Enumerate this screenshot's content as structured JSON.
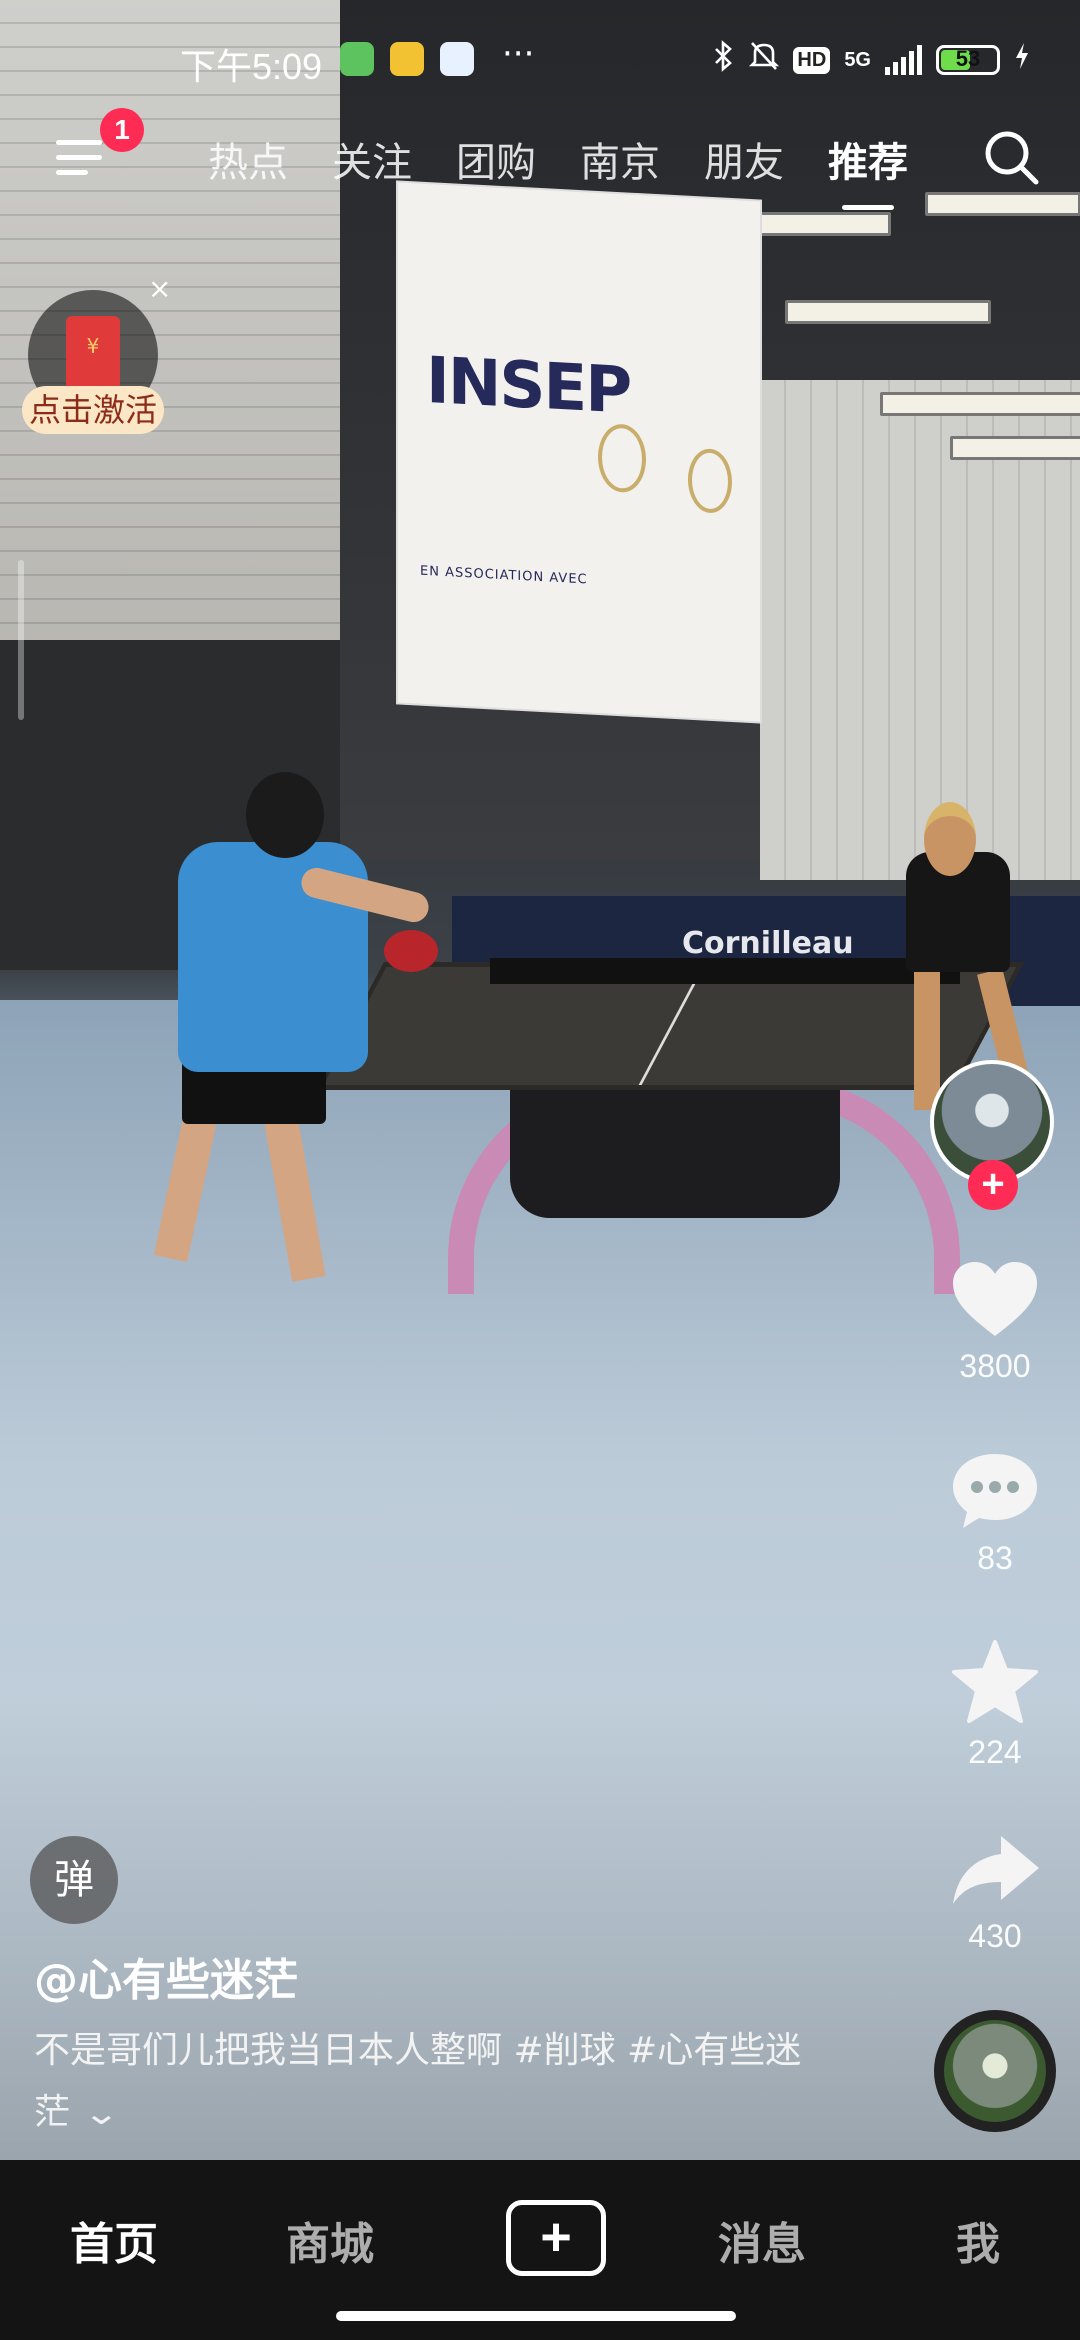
{
  "status_bar": {
    "time": "下午5:09",
    "more": "···",
    "network": "5G",
    "battery": "53",
    "battery_level": 0.53
  },
  "top_nav": {
    "badge": "1",
    "ghost_tab": "",
    "tabs": [
      "热点",
      "关注",
      "团购",
      "南京",
      "朋友",
      "推荐"
    ],
    "active_tab": "推荐"
  },
  "red_packet": {
    "label": "点击激活",
    "close": "×"
  },
  "video": {
    "banner_title": "INSEP",
    "banner_sub": "EN ASSOCIATION AVEC",
    "barrier_text": "Cornilleau"
  },
  "actions": {
    "likes": "3800",
    "comments": "83",
    "favorites": "224",
    "shares": "430"
  },
  "post": {
    "danmaku": "弹",
    "username": "@心有些迷茫",
    "caption": "不是哥们儿把我当日本人整啊 #削球 #心有些迷茫"
  },
  "bottom_bar": {
    "home": "首页",
    "mall": "商城",
    "create": "+",
    "messages": "消息",
    "me": "我"
  },
  "colors": {
    "accent": "#fe2c55",
    "bottom_bar": "#141414"
  }
}
